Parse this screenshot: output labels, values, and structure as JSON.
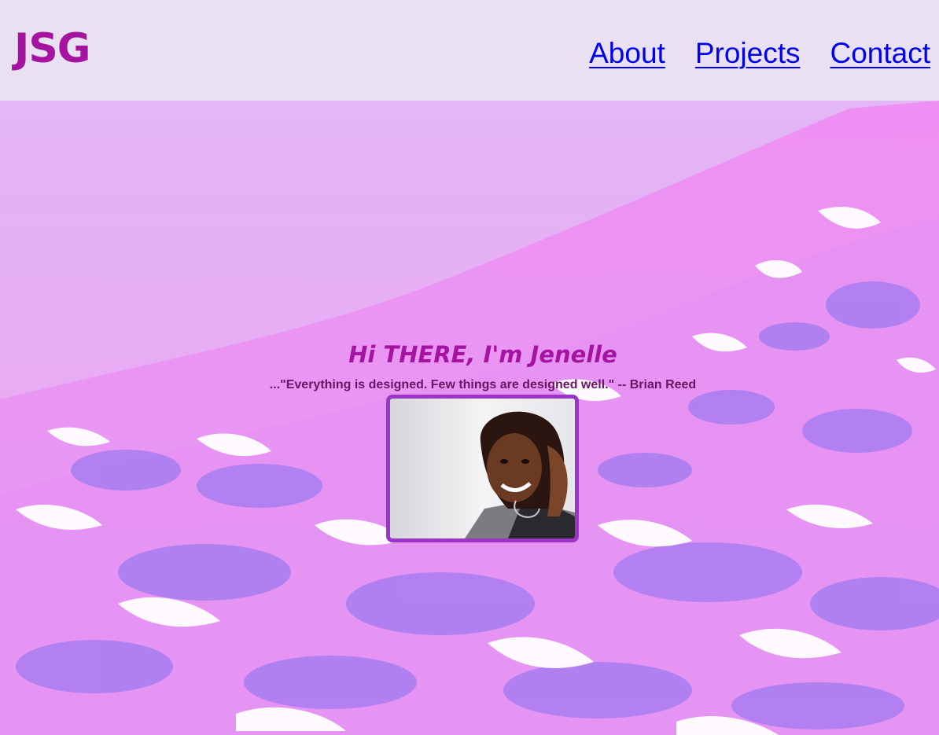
{
  "header": {
    "logo_text": "JSG",
    "nav": [
      {
        "label": "About"
      },
      {
        "label": "Projects"
      },
      {
        "label": "Contact"
      }
    ]
  },
  "hero": {
    "greeting": "Hi THERE, I'm Jenelle",
    "quote": "...\"Everything is designed. Few things are designed well.\" -- Brian Reed",
    "portrait_label": "portrait photo"
  },
  "colors": {
    "header_bg": "#e9e1f2",
    "logo": "#a414a0",
    "link": "#0000ee",
    "frame": "#9b35c9",
    "hero_bg": "#e79af2"
  }
}
